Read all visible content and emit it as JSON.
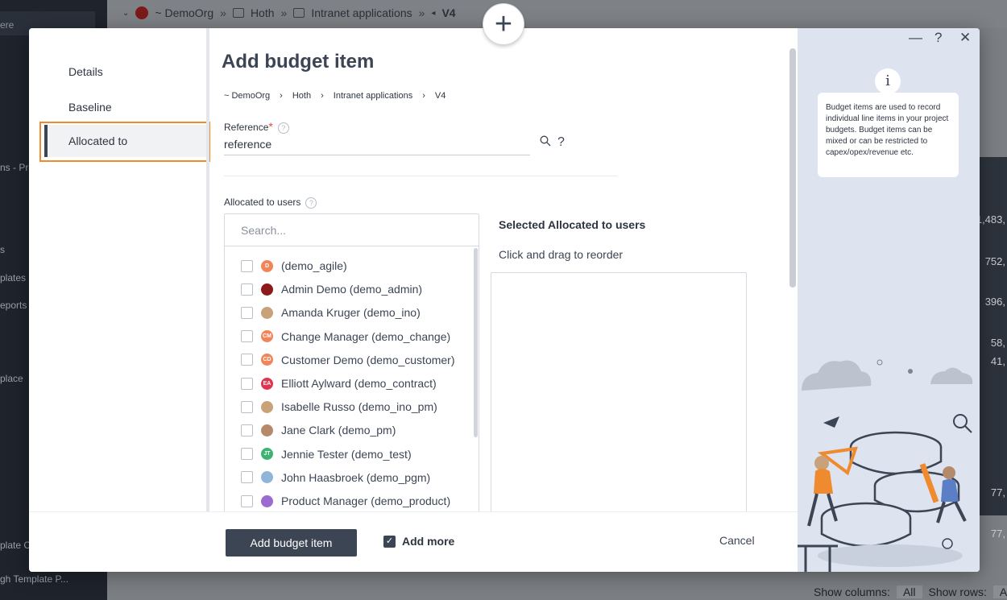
{
  "background": {
    "sidebar_search": "ere",
    "sidebar_items": [
      "ns - Pro",
      "s",
      "plates",
      "eports a",
      "place",
      "plate C",
      "gh Template P..."
    ],
    "breadcrumb": [
      "~ DemoOrg",
      "Hoth",
      "Intranet applications",
      "V4"
    ],
    "table_values": [
      "1,483,",
      "752,",
      "396,",
      "58,",
      "41,",
      "77,",
      "77,"
    ],
    "show_columns_label": "Show columns:",
    "show_columns_value": "All",
    "show_rows_label": "Show rows:",
    "show_rows_value": "A"
  },
  "modal": {
    "title": "Add budget item",
    "nav": {
      "details": "Details",
      "baseline": "Baseline",
      "allocated_to": "Allocated to"
    },
    "breadcrumb": [
      "~ DemoOrg",
      "Hoth",
      "Intranet applications",
      "V4"
    ],
    "reference": {
      "label": "Reference",
      "required_mark": "*",
      "value": "reference"
    },
    "allocated_users": {
      "label": "Allocated to users",
      "search_placeholder": "Search...",
      "users": [
        {
          "name": "(demo_agile)",
          "initials": "D",
          "color": "#f0855a"
        },
        {
          "name": "Admin Demo (demo_admin)",
          "initials": "",
          "color": "#8b1a1a"
        },
        {
          "name": "Amanda Kruger (demo_ino)",
          "initials": "",
          "color": "#c9a27a"
        },
        {
          "name": "Change Manager (demo_change)",
          "initials": "CM",
          "color": "#f0855a"
        },
        {
          "name": "Customer Demo (demo_customer)",
          "initials": "CD",
          "color": "#f0855a"
        },
        {
          "name": "Elliott Aylward (demo_contract)",
          "initials": "EA",
          "color": "#e0344f"
        },
        {
          "name": "Isabelle Russo (demo_ino_pm)",
          "initials": "",
          "color": "#c9a27a"
        },
        {
          "name": "Jane Clark (demo_pm)",
          "initials": "",
          "color": "#b58a6a"
        },
        {
          "name": "Jennie Tester (demo_test)",
          "initials": "JT",
          "color": "#3cb371"
        },
        {
          "name": "John Haasbroek (demo_pgm)",
          "initials": "",
          "color": "#8fb6d9"
        },
        {
          "name": "Product Manager (demo_product)",
          "initials": "",
          "color": "#9b6bd0"
        }
      ]
    },
    "selected": {
      "title": "Selected Allocated to users",
      "hint": "Click and drag to reorder"
    },
    "footer": {
      "primary": "Add budget item",
      "add_more": "Add more",
      "cancel": "Cancel"
    },
    "info": {
      "icon_letter": "i",
      "text": "Budget items are used to record individual line items in your project budgets. Budget items can be mixed or can be restricted to capex/opex/revenue etc."
    },
    "window_controls": {
      "minimize": "—",
      "help": "?",
      "close": "✕"
    },
    "add_icon": "+"
  }
}
